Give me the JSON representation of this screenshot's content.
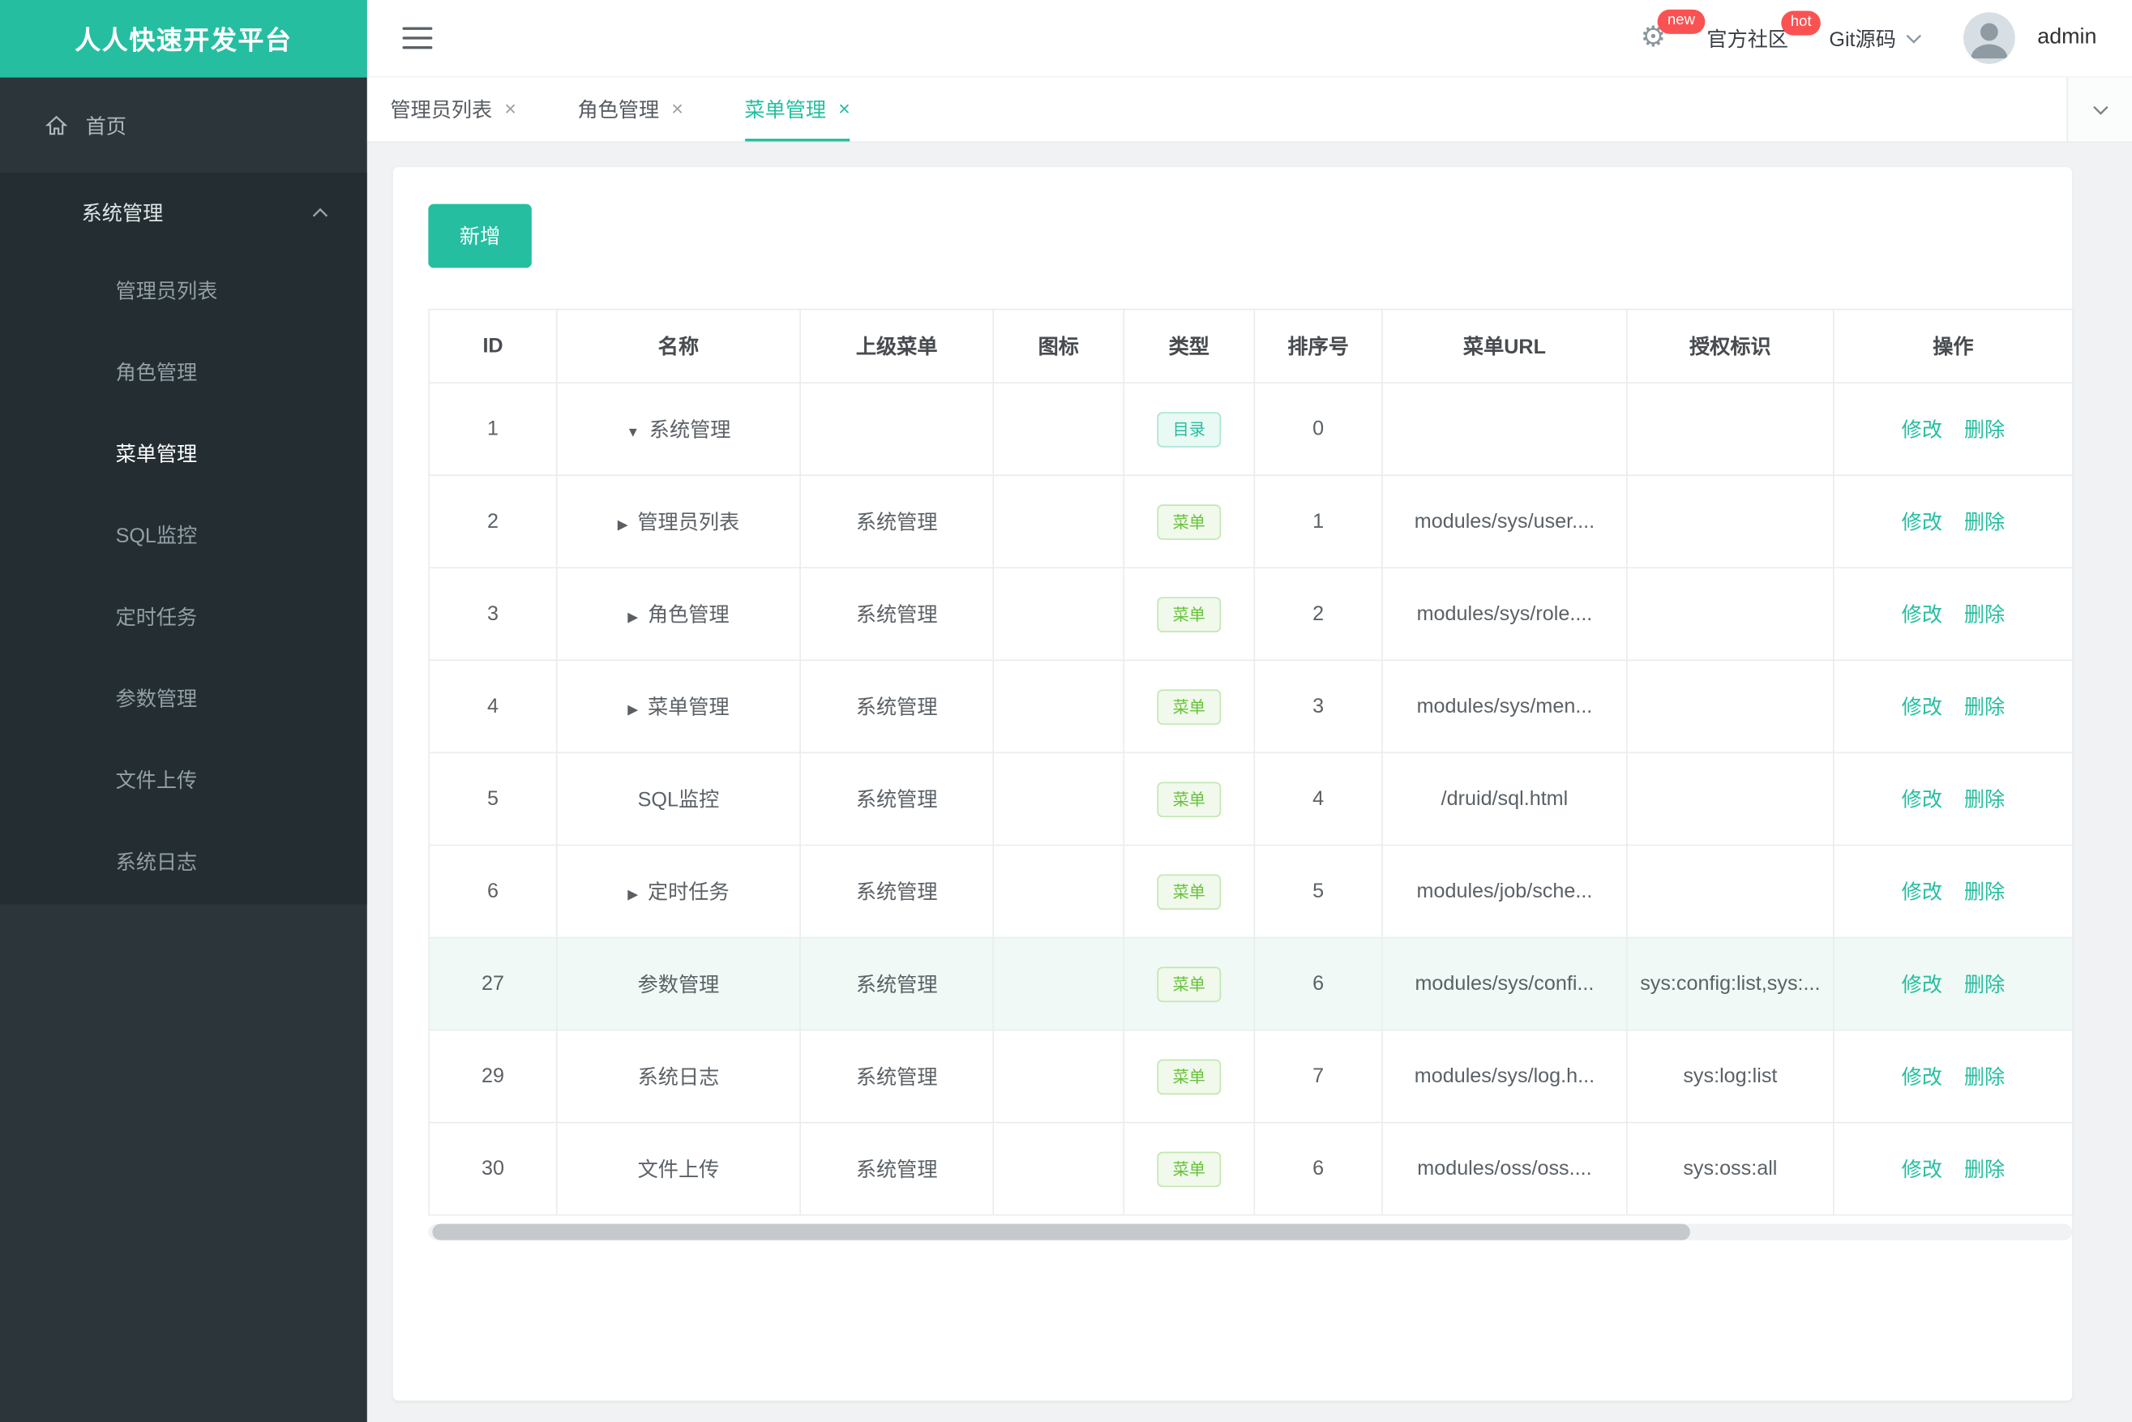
{
  "brand": {
    "title": "人人快速开发平台"
  },
  "colors": {
    "accent": "#26BEA0",
    "danger": "#FA5252",
    "success": "#67C23A",
    "sidebar_bg": "#2B353A"
  },
  "icons": {
    "gear": "⚙",
    "close": "×",
    "caret_down": "▼",
    "caret_right": "▶"
  },
  "header": {
    "badge_new": "new",
    "community": "官方社区",
    "badge_hot": "hot",
    "git": "Git源码",
    "username": "admin"
  },
  "sidebar": {
    "home": "首页",
    "group": "系统管理",
    "items": [
      {
        "label": "管理员列表"
      },
      {
        "label": "角色管理"
      },
      {
        "label": "菜单管理"
      },
      {
        "label": "SQL监控"
      },
      {
        "label": "定时任务"
      },
      {
        "label": "参数管理"
      },
      {
        "label": "文件上传"
      },
      {
        "label": "系统日志"
      }
    ]
  },
  "tabs": [
    {
      "label": "管理员列表"
    },
    {
      "label": "角色管理"
    },
    {
      "label": "菜单管理"
    }
  ],
  "toolbar": {
    "add_label": "新增"
  },
  "table": {
    "headers": [
      "ID",
      "名称",
      "上级菜单",
      "图标",
      "类型",
      "排序号",
      "菜单URL",
      "授权标识",
      "操作"
    ],
    "ops": {
      "edit": "修改",
      "delete": "删除"
    },
    "rows": [
      {
        "id": "1",
        "name": "系统管理",
        "parent": "",
        "type": "目录",
        "order": "0",
        "url": "",
        "perm": ""
      },
      {
        "id": "2",
        "name": "管理员列表",
        "parent": "系统管理",
        "type": "菜单",
        "order": "1",
        "url": "modules/sys/user....",
        "perm": ""
      },
      {
        "id": "3",
        "name": "角色管理",
        "parent": "系统管理",
        "type": "菜单",
        "order": "2",
        "url": "modules/sys/role....",
        "perm": ""
      },
      {
        "id": "4",
        "name": "菜单管理",
        "parent": "系统管理",
        "type": "菜单",
        "order": "3",
        "url": "modules/sys/men...",
        "perm": ""
      },
      {
        "id": "5",
        "name": "SQL监控",
        "parent": "系统管理",
        "type": "菜单",
        "order": "4",
        "url": "/druid/sql.html",
        "perm": ""
      },
      {
        "id": "6",
        "name": "定时任务",
        "parent": "系统管理",
        "type": "菜单",
        "order": "5",
        "url": "modules/job/sche...",
        "perm": ""
      },
      {
        "id": "27",
        "name": "参数管理",
        "parent": "系统管理",
        "type": "菜单",
        "order": "6",
        "url": "modules/sys/confi...",
        "perm": "sys:config:list,sys:..."
      },
      {
        "id": "29",
        "name": "系统日志",
        "parent": "系统管理",
        "type": "菜单",
        "order": "7",
        "url": "modules/sys/log.h...",
        "perm": "sys:log:list"
      },
      {
        "id": "30",
        "name": "文件上传",
        "parent": "系统管理",
        "type": "菜单",
        "order": "6",
        "url": "modules/oss/oss....",
        "perm": "sys:oss:all"
      }
    ]
  }
}
